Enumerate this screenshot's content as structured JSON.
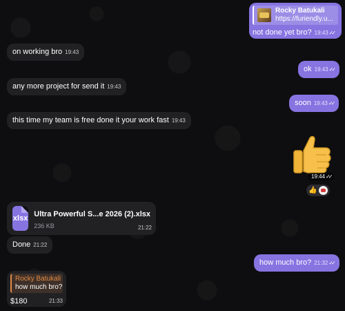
{
  "chat": {
    "messages": [
      {
        "id": "m1",
        "direction": "out",
        "reply": {
          "name": "Rocky Batukali",
          "text": "https://furiendly.u..."
        },
        "text": "not done yet bro?",
        "time": "19:43"
      },
      {
        "id": "m2",
        "direction": "in",
        "text": "on working bro",
        "time": "19:43"
      },
      {
        "id": "m3",
        "direction": "out",
        "text": "ok",
        "time": "19:43"
      },
      {
        "id": "m4",
        "direction": "in",
        "text": "any more project for send it",
        "time": "19:43"
      },
      {
        "id": "m5",
        "direction": "out",
        "text": "soon",
        "time": "19:43"
      },
      {
        "id": "m6",
        "direction": "in",
        "text": "this time my team is free done it your work fast",
        "time": "19:43"
      },
      {
        "id": "m7",
        "direction": "out",
        "type": "sticker",
        "sticker": "thumbs-up",
        "time": "19:44",
        "reactions": [
          {
            "emoji": "👍"
          }
        ]
      },
      {
        "id": "m8",
        "direction": "in",
        "type": "file",
        "file_ext": "xlsx",
        "file_name": "Ultra Powerful S...e 2026 (2).xlsx",
        "file_size": "236 KB",
        "time": "21:22"
      },
      {
        "id": "m9",
        "direction": "in",
        "text": "Done",
        "time": "21:22"
      },
      {
        "id": "m10",
        "direction": "out",
        "text": "how much bro?",
        "time": "21:32"
      },
      {
        "id": "m11",
        "direction": "in",
        "reply": {
          "name": "Rocky Batukali",
          "text": "how much bro?"
        },
        "text": "$180",
        "time": "21:33"
      }
    ],
    "read_ticks": "✓✓"
  },
  "colors": {
    "background": "#0e0e10",
    "incoming_bubble": "#212124",
    "outgoing_bubble": "#8774e1",
    "reply_accent_in": "#e08a45"
  }
}
